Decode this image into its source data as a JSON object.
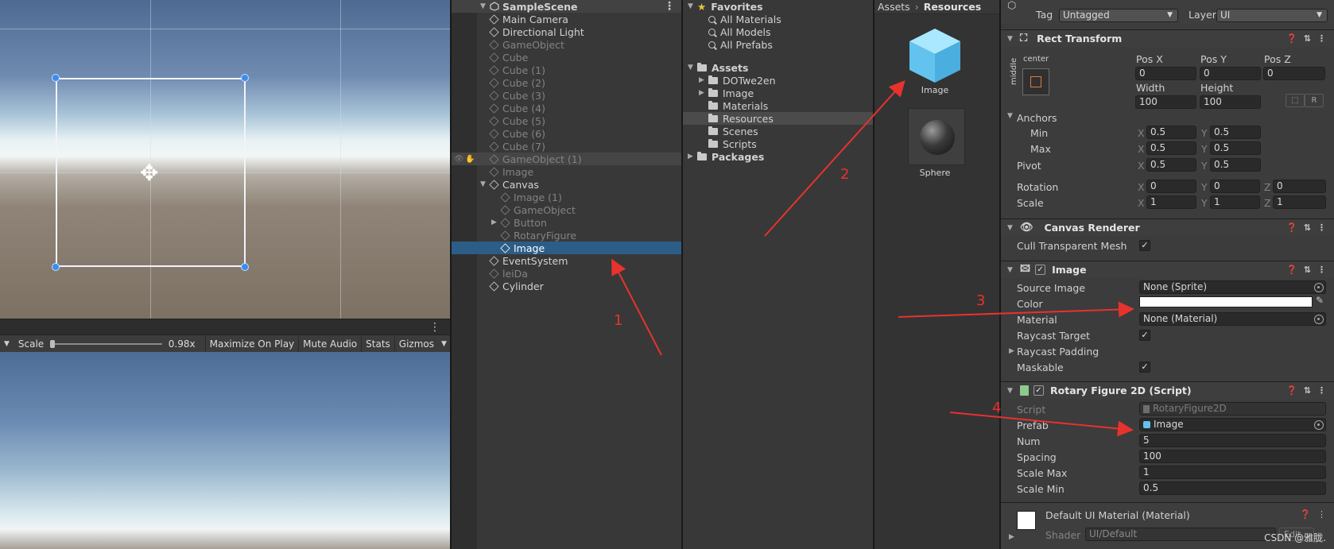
{
  "scene_view": {},
  "game_toolbar": {
    "scale_label": "Scale",
    "scale_value": "0.98x",
    "scale_level": 0.0,
    "buttons": [
      "Maximize On Play",
      "Mute Audio",
      "Stats",
      "Gizmos"
    ]
  },
  "hierarchy": {
    "scene_name": "SampleScene",
    "items": [
      {
        "label": "Main Camera",
        "indent": 1,
        "active": true
      },
      {
        "label": "Directional Light",
        "indent": 1,
        "active": true
      },
      {
        "label": "GameObject",
        "indent": 1,
        "active": false
      },
      {
        "label": "Cube",
        "indent": 1,
        "active": false
      },
      {
        "label": "Cube (1)",
        "indent": 1,
        "active": false
      },
      {
        "label": "Cube (2)",
        "indent": 1,
        "active": false
      },
      {
        "label": "Cube (3)",
        "indent": 1,
        "active": false
      },
      {
        "label": "Cube (4)",
        "indent": 1,
        "active": false
      },
      {
        "label": "Cube (5)",
        "indent": 1,
        "active": false
      },
      {
        "label": "Cube (6)",
        "indent": 1,
        "active": false
      },
      {
        "label": "Cube (7)",
        "indent": 1,
        "active": false
      },
      {
        "label": "GameObject (1)",
        "indent": 1,
        "active": false
      },
      {
        "label": "Image",
        "indent": 1,
        "active": false
      },
      {
        "label": "Canvas",
        "indent": 1,
        "active": true,
        "expanded": true
      },
      {
        "label": "Image (1)",
        "indent": 2,
        "active": false
      },
      {
        "label": "GameObject",
        "indent": 2,
        "active": false
      },
      {
        "label": "Button",
        "indent": 2,
        "active": false,
        "collapsed": true
      },
      {
        "label": "RotaryFigure",
        "indent": 2,
        "active": false
      },
      {
        "label": "Image",
        "indent": 2,
        "active": true,
        "selected": true
      },
      {
        "label": "EventSystem",
        "indent": 1,
        "active": true
      },
      {
        "label": "leiDa",
        "indent": 1,
        "active": false
      },
      {
        "label": "Cylinder",
        "indent": 1,
        "active": true
      }
    ]
  },
  "project": {
    "favorites_label": "Favorites",
    "favorites": [
      "All Materials",
      "All Models",
      "All Prefabs"
    ],
    "assets_label": "Assets",
    "folders": [
      {
        "label": "DOTwe2en",
        "collapsed": true
      },
      {
        "label": "Image",
        "collapsed": true
      },
      {
        "label": "Materials"
      },
      {
        "label": "Resources",
        "selected": true
      },
      {
        "label": "Scenes"
      },
      {
        "label": "Scripts"
      }
    ],
    "packages_label": "Packages"
  },
  "asset_browser": {
    "breadcrumb": [
      "Assets",
      "Resources"
    ],
    "items": [
      "Image",
      "Sphere"
    ]
  },
  "inspector": {
    "tag_label": "Tag",
    "tag_value": "Untagged",
    "layer_label": "Layer",
    "layer_value": "UI",
    "rect_transform": {
      "title": "Rect Transform",
      "anchor_preset_h": "center",
      "anchor_preset_v": "middle",
      "pos_x_label": "Pos X",
      "pos_x": "0",
      "pos_y_label": "Pos Y",
      "pos_y": "0",
      "pos_z_label": "Pos Z",
      "pos_z": "0",
      "width_label": "Width",
      "width": "100",
      "height_label": "Height",
      "height": "100",
      "raw_button": "R",
      "anchors_label": "Anchors",
      "min_label": "Min",
      "min_x": "0.5",
      "min_y": "0.5",
      "max_label": "Max",
      "max_x": "0.5",
      "max_y": "0.5",
      "pivot_label": "Pivot",
      "pivot_x": "0.5",
      "pivot_y": "0.5",
      "rotation_label": "Rotation",
      "rot_x": "0",
      "rot_y": "0",
      "rot_z": "0",
      "scale_label": "Scale",
      "scale_x": "1",
      "scale_y": "1",
      "scale_z": "1",
      "x_letter": "X",
      "y_letter": "Y",
      "z_letter": "Z"
    },
    "canvas_renderer": {
      "title": "Canvas Renderer",
      "cull_label": "Cull Transparent Mesh"
    },
    "image": {
      "title": "Image",
      "source_image_label": "Source Image",
      "source_image": "None (Sprite)",
      "color_label": "Color",
      "color_value": "#ffffff",
      "material_label": "Material",
      "material": "None (Material)",
      "raycast_target_label": "Raycast Target",
      "raycast_padding_label": "Raycast Padding",
      "maskable_label": "Maskable"
    },
    "rotary": {
      "title": "Rotary Figure 2D (Script)",
      "script_label": "Script",
      "script_value": "RotaryFigure2D",
      "prefab_label": "Prefab",
      "prefab_value": "Image",
      "num_label": "Num",
      "num": "5",
      "spacing_label": "Spacing",
      "spacing": "100",
      "scale_max_label": "Scale Max",
      "scale_max": "1",
      "scale_min_label": "Scale Min",
      "scale_min": "0.5"
    },
    "material_section": {
      "title": "Default UI Material (Material)",
      "shader_label": "Shader",
      "shader_value": "UI/Default",
      "edit_button": "Edit..."
    }
  },
  "annotations": [
    "1",
    "2",
    "3",
    "4"
  ],
  "watermark": "CSDN @雅胧.",
  "colors": {
    "accent_blue": "#2c5d87",
    "arrow_red": "#e8322d"
  }
}
